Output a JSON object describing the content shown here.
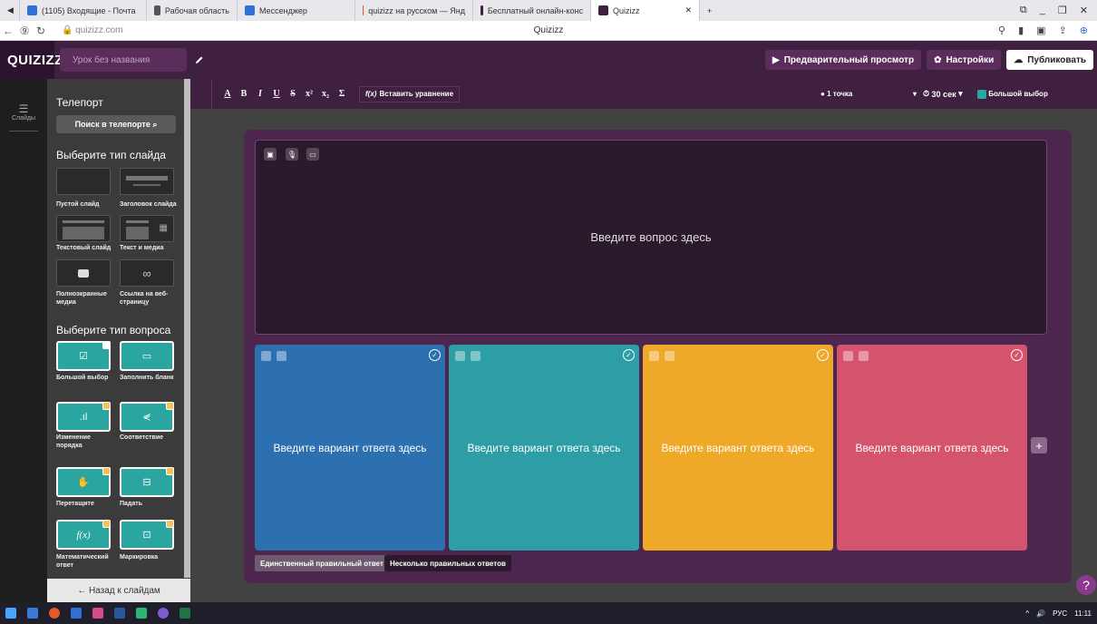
{
  "browser": {
    "tabs": [
      {
        "label": "(1105) Входящие - Почта",
        "color": "#2f6fd6"
      },
      {
        "label": "Рабочая область",
        "color": "#555555"
      },
      {
        "label": "Мессенджер",
        "color": "#2f6fd6"
      },
      {
        "label": "quizizz на русском — Янд",
        "color": "#e0532d"
      },
      {
        "label": "Бесплатный онлайн-конс",
        "color": "#3f2040"
      },
      {
        "label": "Quizizz",
        "color": "#3f2040"
      }
    ],
    "url": "quizizz.com",
    "page_title": "Quizizz"
  },
  "app": {
    "logo": "QUIZIZZ",
    "lesson_name": "Урок без названия",
    "preview_label": "Предварительный просмотр",
    "settings_label": "Настройки",
    "publish_label": "Публиковать"
  },
  "rail": {
    "slides_label": "Слайды"
  },
  "panel": {
    "title": "Телепорт",
    "search_label": "Поиск в телепорте",
    "slide_type_heading": "Выберите тип слайда",
    "slide_types": [
      "Пустой слайд",
      "Заголовок слайда",
      "Текстовый слайд",
      "Текст и медиа",
      "Полноэкранные медиа",
      "Ссылка на веб-страницу"
    ],
    "question_type_heading": "Выберите тип вопроса",
    "question_types": [
      "Большой выбор",
      "Заполнить бланк",
      "Изменение порядка",
      "Соответствие",
      "Перетащите",
      "Падать",
      "Математический ответ",
      "Маркировка"
    ],
    "back_label": "← Назад к слайдам"
  },
  "toolbar": {
    "format_buttons": [
      "A",
      "B",
      "I",
      "U",
      "S",
      "x²",
      "x₂",
      "Σ"
    ],
    "equation_label": "Вставить уравнение",
    "points_label": "1 точка",
    "time_label": "30 сек",
    "qtype_label": "Большой выбор"
  },
  "question": {
    "placeholder": "Введите вопрос здесь"
  },
  "answers": [
    {
      "placeholder": "Введите вариант ответа здесь",
      "color": "#2d70af"
    },
    {
      "placeholder": "Введите вариант ответа здесь",
      "color": "#2d9ea6"
    },
    {
      "placeholder": "Введите вариант ответа здесь",
      "color": "#efa929"
    },
    {
      "placeholder": "Введите вариант ответа здесь",
      "color": "#d5546d"
    }
  ],
  "modes": {
    "single": "Единственный правильный ответ",
    "multiple": "Несколько правильных ответов"
  },
  "taskbar": {
    "lang": "РУС",
    "time": "11:11"
  }
}
